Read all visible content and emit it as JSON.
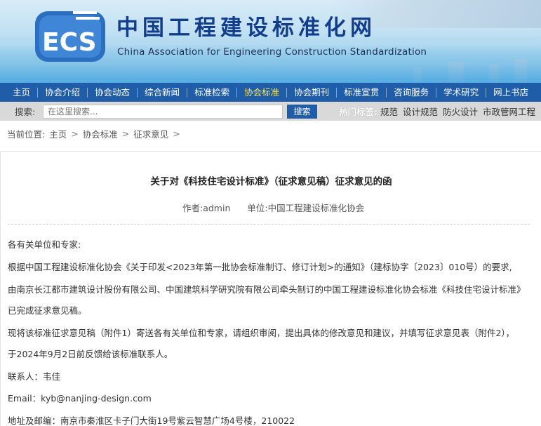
{
  "header": {
    "logo_text": "ECS",
    "cn_title": "中国工程建设标准化网",
    "en_title": "China Association for Engineering Construction Standardization"
  },
  "nav": {
    "items": [
      {
        "label": "主页",
        "active": false
      },
      {
        "label": "协会介绍",
        "active": false
      },
      {
        "label": "协会动态",
        "active": false
      },
      {
        "label": "综合新闻",
        "active": false
      },
      {
        "label": "标准检索",
        "active": false
      },
      {
        "label": "协会标准",
        "active": true
      },
      {
        "label": "协会期刊",
        "active": false
      },
      {
        "label": "标准宣贯",
        "active": false
      },
      {
        "label": "咨询服务",
        "active": false
      },
      {
        "label": "学术研究",
        "active": false
      },
      {
        "label": "网上书店",
        "active": false
      }
    ]
  },
  "search": {
    "label": "搜索:",
    "placeholder": "在这里搜索...",
    "button": "搜索",
    "hot_label": "热门标签:",
    "hot_tags": [
      "规范",
      "设计规范",
      "防火设计",
      "市政管网工程"
    ]
  },
  "breadcrumb": {
    "items": [
      "当前位置:",
      "主页",
      "协会标准",
      "征求意见"
    ]
  },
  "article": {
    "title": "关于对《科技住宅设计标准》（征求意见稿）征求意见的函",
    "author": "作者:admin",
    "unit": "单位:中国工程建设标准化协会",
    "paragraphs": [
      "各有关单位和专家:",
      "根据中国工程建设标准化协会《关于印发<2023年第一批协会标准制订、修订计划>的通知》（建标协字〔2023〕010号）的要求,",
      "由南京长江都市建筑设计股份有限公司、中国建筑科学研究院有限公司牵头制订的中国工程建设标准化协会标准《科技住宅设计标准》",
      "已完成征求意见稿。",
      "现将该标准征求意见稿（附件1）寄送各有关单位和专家，请组织审阅，提出具体的修改意见和建议，并填写征求意见表（附件2），",
      "于2024年9月2日前反馈给该标准联系人。",
      "联系人：韦佳",
      "Email：kyb@nanjing-design.com",
      "地址及邮编：南京市秦淮区卡子门大街19号紫云智慧广场4号楼，210022"
    ]
  },
  "colors": {
    "nav_bg": "#1f5da8",
    "nav_active": "#f7e35a",
    "title_blue": "#123d8c"
  }
}
